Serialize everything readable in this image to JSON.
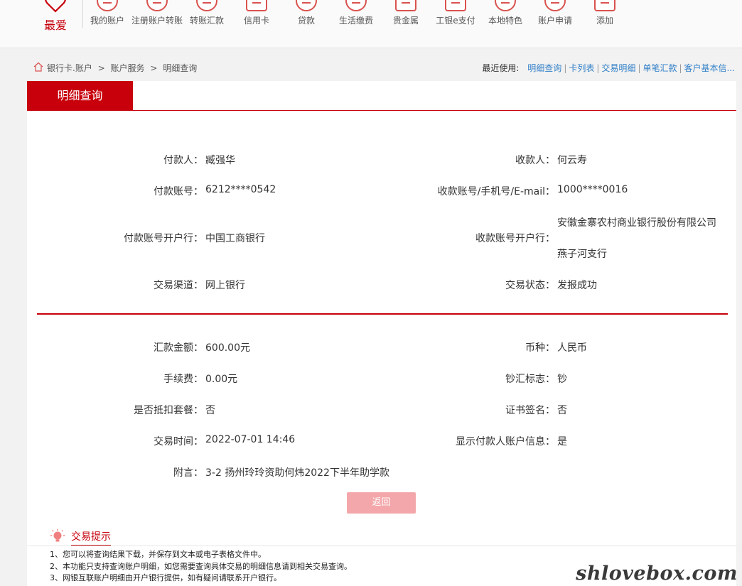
{
  "nav": {
    "favorite_label": "最爱",
    "items": [
      {
        "label": "我的账户"
      },
      {
        "label": "注册账户转账"
      },
      {
        "label": "转账汇款"
      },
      {
        "label": "信用卡"
      },
      {
        "label": "贷款"
      },
      {
        "label": "生活缴费"
      },
      {
        "label": "贵金属"
      },
      {
        "label": "工银e支付"
      },
      {
        "label": "本地特色"
      },
      {
        "label": "账户申请"
      },
      {
        "label": "添加"
      }
    ]
  },
  "breadcrumb": {
    "items": [
      "银行卡.账户",
      "账户服务",
      "明细查询"
    ],
    "separator": ">"
  },
  "recent": {
    "label": "最近使用:",
    "links": [
      "明细查询",
      "卡列表",
      "交易明细",
      "单笔汇款",
      "客户基本信..."
    ]
  },
  "tab": {
    "active_label": "明细查询"
  },
  "details": {
    "payer_label": "付款人：",
    "payer": "臧强华",
    "payee_label": "收款人：",
    "payee": "何云寿",
    "payer_account_label": "付款账号：",
    "payer_account": "6212****0542",
    "payee_account_label": "收款账号/手机号/E-mail：",
    "payee_account": "1000****0016",
    "payer_bank_label": "付款账号开户行：",
    "payer_bank": "中国工商银行",
    "payee_bank_label": "收款账号开户行：",
    "payee_bank_line1": "安徽金寨农村商业银行股份有限公司",
    "payee_bank_line2": "燕子河支行",
    "channel_label": "交易渠道：",
    "channel": "网上银行",
    "status_label": "交易状态：",
    "status": "发报成功",
    "amount_label": "汇款金额：",
    "amount": "600.00元",
    "currency_label": "币种：",
    "currency": "人民币",
    "fee_label": "手续费：",
    "fee": "0.00元",
    "cash_flag_label": "钞汇标志：",
    "cash_flag": "钞",
    "package_label": "是否抵扣套餐：",
    "package": "否",
    "cert_label": "证书签名：",
    "cert": "否",
    "time_label": "交易时间：",
    "time": "2022-07-01 14:46",
    "show_payer_label": "显示付款人账户信息：",
    "show_payer": "是",
    "memo_label": "附言：",
    "memo": "3-2 扬州玲玲资助何炜2022下半年助学款"
  },
  "back_button_label": "返回",
  "tips": {
    "title": "交易提示",
    "lines": [
      "1、您可以将查询结果下载，并保存到文本或电子表格文件中。",
      "2、本功能只支持查询账户明细，如您需要查询具体交易的明细信息请到相关交易查询。",
      "3、网银互联账户明细由开户银行提供，如有疑问请联系开户银行。"
    ]
  },
  "watermark": "shlovebox.com",
  "colors": {
    "accent": "#c7000b",
    "link": "#2f7ec7",
    "button_disabled": "#f4a7aa"
  }
}
